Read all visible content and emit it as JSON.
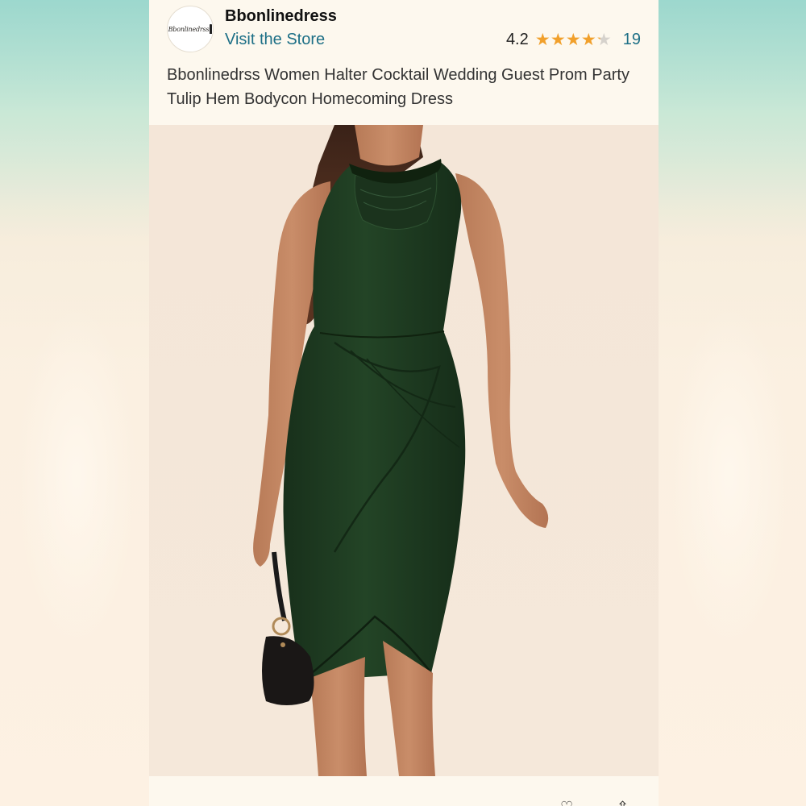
{
  "store": {
    "logo_text": "Bbonlinedrss",
    "name": "Bbonlinedress",
    "visit_label": "Visit the Store"
  },
  "rating": {
    "value": "4.2",
    "stars_filled_fraction": 0.84,
    "review_count": "19",
    "star_icon": "star-icon",
    "accent_color": "#f1a02b",
    "link_color": "#1d6f86"
  },
  "product": {
    "title": "Bbonlinedrss Women Halter Cocktail Wedding Guest Prom Party Tulip Hem Bodycon Homecoming Dress",
    "dress_color": "#1f3a22"
  }
}
